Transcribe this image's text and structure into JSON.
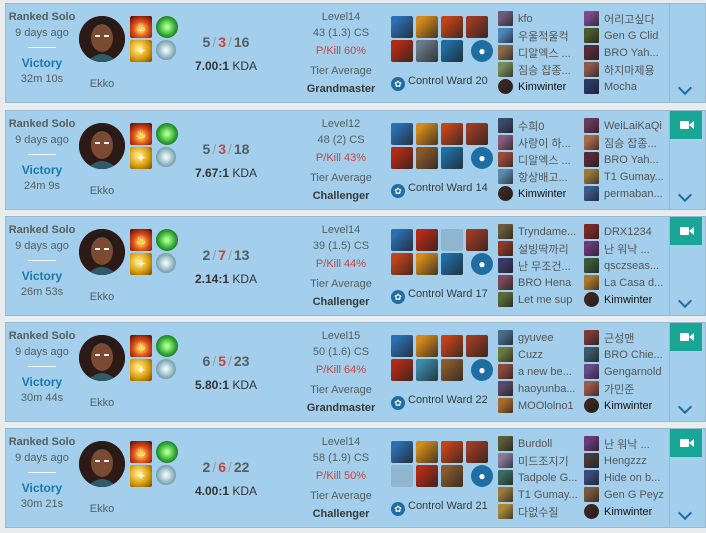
{
  "matches": [
    {
      "queue": "Ranked Solo",
      "time_ago": "9 days ago",
      "result": "Victory",
      "duration": "32m 10s",
      "champion": "Ekko",
      "kills": "5",
      "deaths": "3",
      "assists": "16",
      "kda_ratio": "7.00:1",
      "kda_suffix": "KDA",
      "level": "Level14",
      "cs": "43 (1.3) CS",
      "pkill": "P/Kill 60%",
      "tier_label": "Tier Average",
      "tier": "Grandmaster",
      "ward_label": "Control Ward 20",
      "has_video": false,
      "items": [
        "#2b6fb3",
        "#d48a1a",
        "#c44218",
        "#b42a15",
        "#6b7a88",
        "#1f6ea3"
      ],
      "team1": [
        {
          "name": "kfo",
          "icon": "#6f5a7a"
        },
        {
          "name": "우울적울컥",
          "icon": "#4c86b8"
        },
        {
          "name": "디알엑스 ...",
          "icon": "#8a6a4a"
        },
        {
          "name": "짐승 잡종...",
          "icon": "#7a8a5a"
        },
        {
          "name": "Kimwinter",
          "icon": "#3c2620",
          "me": true
        }
      ],
      "team2": [
        {
          "name": "어리고싶다",
          "icon": "#7a4a8a"
        },
        {
          "name": "Gen G Clid",
          "icon": "#4a5a2a"
        },
        {
          "name": "BRO Yah...",
          "icon": "#5a2a3a"
        },
        {
          "name": "하지마제용",
          "icon": "#8a5a4a"
        },
        {
          "name": "Mocha",
          "icon": "#2a3a6a"
        }
      ]
    },
    {
      "queue": "Ranked Solo",
      "time_ago": "9 days ago",
      "result": "Victory",
      "duration": "24m 9s",
      "champion": "Ekko",
      "kills": "5",
      "deaths": "3",
      "assists": "18",
      "kda_ratio": "7.67:1",
      "kda_suffix": "KDA",
      "level": "Level12",
      "cs": "48 (2) CS",
      "pkill": "P/Kill 43%",
      "tier_label": "Tier Average",
      "tier": "Challenger",
      "ward_label": "Control Ward 14",
      "has_video": true,
      "items": [
        "#2b6fb3",
        "#d48a1a",
        "#c44218",
        "#b42a15",
        "#8a5a2a",
        "#1f6ea3"
      ],
      "team1": [
        {
          "name": "수희0",
          "icon": "#3a4a6a"
        },
        {
          "name": "사랑이 하...",
          "icon": "#8a5a7a"
        },
        {
          "name": "디알엑스 ...",
          "icon": "#9a4a3a"
        },
        {
          "name": "항상배고...",
          "icon": "#5a8aaa"
        },
        {
          "name": "Kimwinter",
          "icon": "#3c2620",
          "me": true
        }
      ],
      "team2": [
        {
          "name": "WeiLaiKaQi",
          "icon": "#6a3a5a"
        },
        {
          "name": "짐승 잡종...",
          "icon": "#aa6a4a"
        },
        {
          "name": "BRO Yah...",
          "icon": "#5a2a3a"
        },
        {
          "name": "T1 Gumay...",
          "icon": "#9a7a3a"
        },
        {
          "name": "permaban...",
          "icon": "#3a5a8a"
        }
      ]
    },
    {
      "queue": "Ranked Solo",
      "time_ago": "9 days ago",
      "result": "Victory",
      "duration": "26m 53s",
      "champion": "Ekko",
      "kills": "2",
      "deaths": "7",
      "assists": "13",
      "kda_ratio": "2.14:1",
      "kda_suffix": "KDA",
      "level": "Level14",
      "cs": "39 (1.5) CS",
      "pkill": "P/Kill 44%",
      "tier_label": "Tier Average",
      "tier": "Challenger",
      "ward_label": "Control Ward 17",
      "has_video": true,
      "items": [
        "#2b6fb3",
        "#b42a15",
        "",
        "#c44218",
        "#d48a1a",
        "#1f6ea3"
      ],
      "team1": [
        {
          "name": "Tryndame...",
          "icon": "#6a5a3a"
        },
        {
          "name": "설빙딱까리",
          "icon": "#8a3a2a"
        },
        {
          "name": "난 무조건...",
          "icon": "#3a3a6a"
        },
        {
          "name": "BRO Hena",
          "icon": "#7a4a5a"
        },
        {
          "name": "Let me sup",
          "icon": "#5a6a3a"
        }
      ],
      "team2": [
        {
          "name": "DRX1234",
          "icon": "#7a2a2a"
        },
        {
          "name": "난 워낙 ...",
          "icon": "#6a3a7a"
        },
        {
          "name": "qsczseas...",
          "icon": "#3a5a3a"
        },
        {
          "name": "La Casa d...",
          "icon": "#aa7a2a"
        },
        {
          "name": "Kimwinter",
          "icon": "#3c2620",
          "me": true
        }
      ]
    },
    {
      "queue": "Ranked Solo",
      "time_ago": "9 days ago",
      "result": "Victory",
      "duration": "30m 44s",
      "champion": "Ekko",
      "kills": "6",
      "deaths": "5",
      "assists": "23",
      "kda_ratio": "5.80:1",
      "kda_suffix": "KDA",
      "level": "Level15",
      "cs": "50 (1.6) CS",
      "pkill": "P/Kill 64%",
      "tier_label": "Tier Average",
      "tier": "Grandmaster",
      "ward_label": "Control Ward 22",
      "has_video": true,
      "items": [
        "#2b6fb3",
        "#d48a1a",
        "#c44218",
        "#b42a15",
        "#3a8aaa",
        "#8a5a2a"
      ],
      "team1": [
        {
          "name": "gyuvee",
          "icon": "#4a6a8a"
        },
        {
          "name": "Cuzz",
          "icon": "#6a7a3a"
        },
        {
          "name": "a new be...",
          "icon": "#8a4a3a"
        },
        {
          "name": "haoyunba...",
          "icon": "#5a4a6a"
        },
        {
          "name": "MOOlolno1",
          "icon": "#aa6a2a"
        }
      ],
      "team2": [
        {
          "name": "근성맨",
          "icon": "#7a3a3a"
        },
        {
          "name": "BRO Chie...",
          "icon": "#3a5a6a"
        },
        {
          "name": "Gengarnold",
          "icon": "#6a4a8a"
        },
        {
          "name": "가민준",
          "icon": "#9a5a4a"
        },
        {
          "name": "Kimwinter",
          "icon": "#3c2620",
          "me": true
        }
      ]
    },
    {
      "queue": "Ranked Solo",
      "time_ago": "9 days ago",
      "result": "Victory",
      "duration": "30m 21s",
      "champion": "Ekko",
      "kills": "2",
      "deaths": "6",
      "assists": "22",
      "kda_ratio": "4.00:1",
      "kda_suffix": "KDA",
      "level": "Level14",
      "cs": "58 (1.9) CS",
      "pkill": "P/Kill 50%",
      "tier_label": "Tier Average",
      "tier": "Challenger",
      "ward_label": "Control Ward 21",
      "has_video": true,
      "items": [
        "#2b6fb3",
        "#d48a1a",
        "#c44218",
        "",
        "#b42a15",
        "#8a5a2a"
      ],
      "team1": [
        {
          "name": "Burdoll",
          "icon": "#5a5a3a"
        },
        {
          "name": "미드조지기",
          "icon": "#8a7a9a"
        },
        {
          "name": "Tadpole G...",
          "icon": "#3a6a5a"
        },
        {
          "name": "T1 Gumay...",
          "icon": "#9a7a3a"
        },
        {
          "name": "다없수질",
          "icon": "#aa8a3a"
        }
      ],
      "team2": [
        {
          "name": "난 워낙 ...",
          "icon": "#6a3a7a"
        },
        {
          "name": "Hengzzz",
          "icon": "#4a3a3a"
        },
        {
          "name": "Hide on b...",
          "icon": "#3a4a7a"
        },
        {
          "name": "Gen G Peyz",
          "icon": "#7a5a3a"
        },
        {
          "name": "Kimwinter",
          "icon": "#3c2620",
          "me": true
        }
      ]
    }
  ]
}
